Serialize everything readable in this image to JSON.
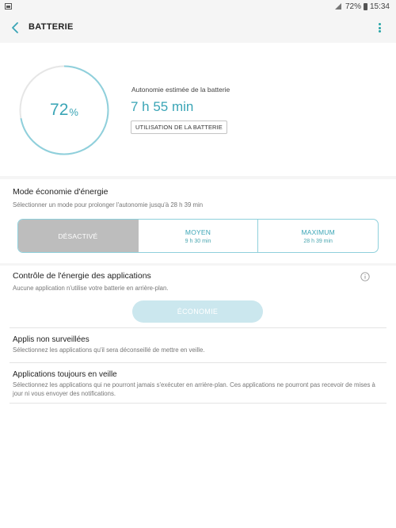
{
  "status_bar": {
    "battery": "72%",
    "time": "15:34"
  },
  "app_bar": {
    "title": "BATTERIE"
  },
  "battery": {
    "percent_value": "72",
    "percent_sign": "%",
    "percent_fraction": 0.72,
    "estimated_label": "Autonomie estimée de la batterie",
    "estimated_time": "7 h 55 min",
    "usage_button": "UTILISATION DE LA BATTERIE"
  },
  "power_saving": {
    "title": "Mode économie d'énergie",
    "subtitle": "Sélectionner un mode pour prolonger l'autonomie jusqu'à 28 h 39 min",
    "modes": [
      {
        "label": "DÉSACTIVÉ",
        "sub": ""
      },
      {
        "label": "MOYEN",
        "sub": "9 h 30 min"
      },
      {
        "label": "MAXIMUM",
        "sub": "28 h 39 min"
      }
    ]
  },
  "app_power": {
    "title": "Contrôle de l'énergie des applications",
    "subtitle": "Aucune application n'utilise votre batterie en arrière-plan.",
    "button": "ÉCONOMIE",
    "items": [
      {
        "title": "Applis non surveillées",
        "sub": "Sélectionnez les applications qu'il sera déconseillé de mettre en veille."
      },
      {
        "title": "Applications toujours en veille",
        "sub": "Sélectionnez les applications qui ne pourront jamais s'exécuter en arrière-plan. Ces applications ne pourront pas recevoir de mises à jour ni vous envoyer des notifications."
      }
    ]
  },
  "colors": {
    "accent": "#3aa5b6",
    "ring_track": "#e6e6e6",
    "ring_fill": "#8fd0dc"
  }
}
